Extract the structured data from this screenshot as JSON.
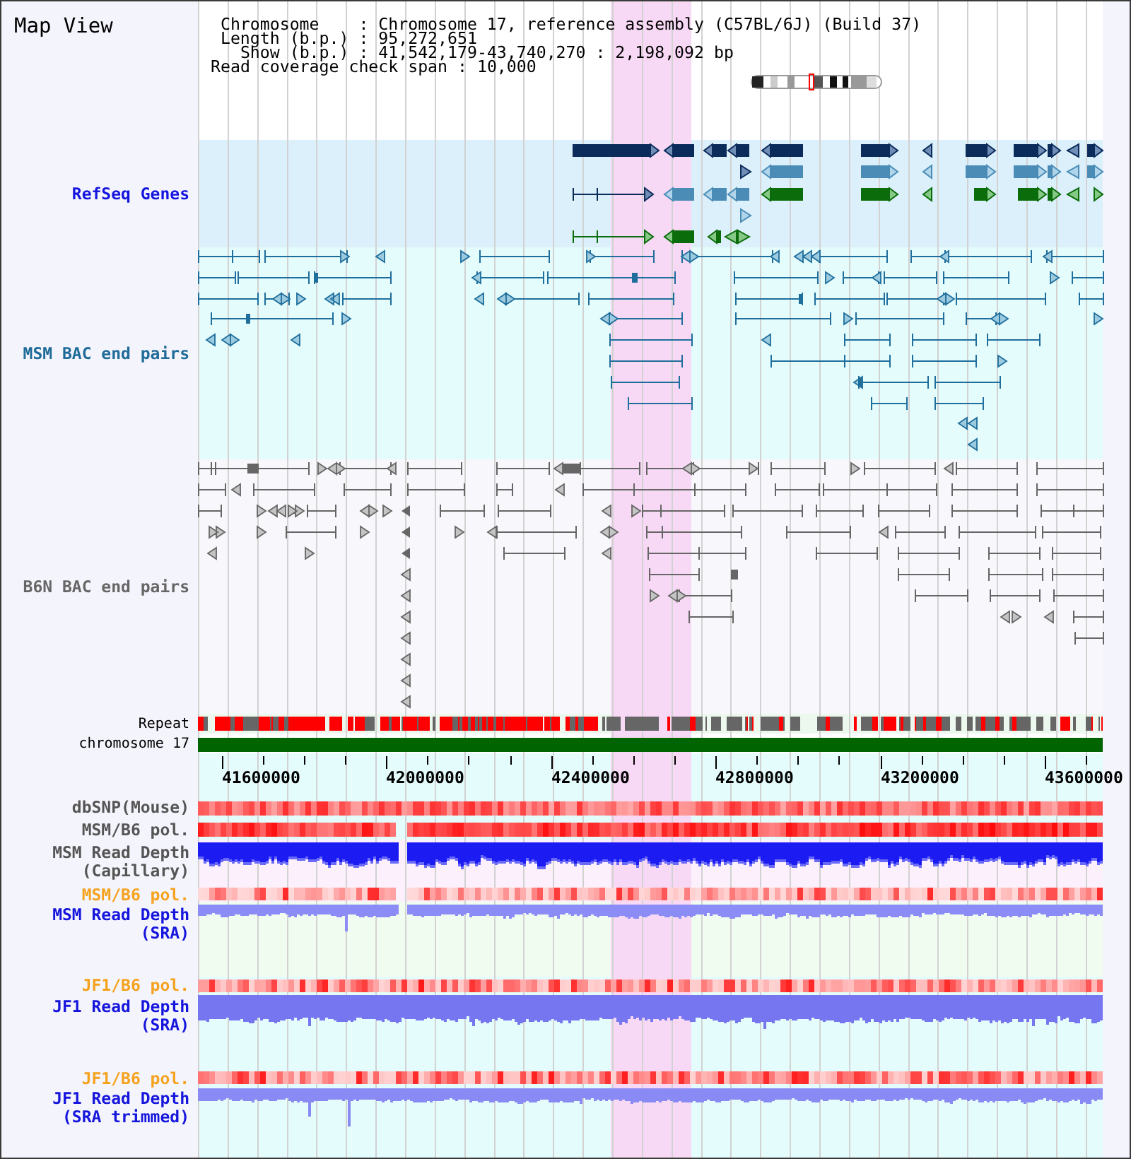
{
  "view_title": "Map View",
  "info_lines": [
    "Chromosome    : Chromosome 17, reference assembly (C57BL/6J) (Build 37)",
    "Length (b.p.) : 95,272,651",
    "Show (b.p.) : 41,542,179-43,740,270 : 2,198,092 bp",
    "Read coverage check span : 10,000"
  ],
  "tracks": [
    {
      "kind": "genes",
      "label": "RefSeq Genes",
      "color": "#1414e0"
    },
    {
      "kind": "bac",
      "label": "MSM BAC end pairs",
      "color": "#1f6b99"
    },
    {
      "kind": "bac",
      "label": "B6N BAC end pairs",
      "color": "#666666"
    },
    {
      "kind": "repeat",
      "label": "Repeat",
      "color": "#000000"
    },
    {
      "kind": "chromosome",
      "label": "chromosome 17",
      "color": "#000000"
    },
    {
      "kind": "axis",
      "ticks": [
        "41600000",
        "42000000",
        "42400000",
        "42800000",
        "43200000",
        "43600000"
      ]
    },
    {
      "kind": "heat",
      "label": "dbSNP(Mouse)",
      "color": "#555555"
    },
    {
      "kind": "heat",
      "label": "MSM/B6 pol.",
      "color": "#555555"
    },
    {
      "kind": "depth",
      "label": "MSM Read Depth (Capillary)",
      "color": "#555555"
    },
    {
      "kind": "heat",
      "label": "MSM/B6 pol.",
      "color": "#f5a21e"
    },
    {
      "kind": "depth",
      "label": "MSM Read Depth (SRA)",
      "color": "#1515dd"
    },
    {
      "kind": "heat",
      "label": "JF1/B6 pol.",
      "color": "#f5a21e"
    },
    {
      "kind": "depth",
      "label": "JF1 Read Depth (SRA)",
      "color": "#1515dd"
    },
    {
      "kind": "heat",
      "label": "JF1/B6 pol.",
      "color": "#f5a21e"
    },
    {
      "kind": "depth",
      "label": "JF1 Read Depth (SRA trimmed)",
      "color": "#1515dd"
    }
  ]
}
